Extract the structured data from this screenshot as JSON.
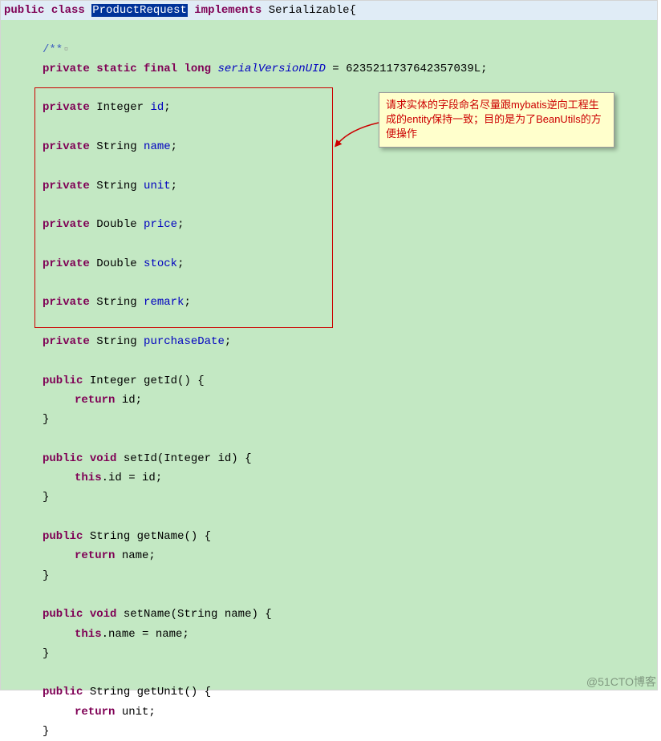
{
  "decl": {
    "public": "public",
    "class": "class",
    "name": "ProductRequest",
    "implements": "implements",
    "iface": "Serializable{"
  },
  "comment": "/**",
  "svuid_line": {
    "mods": "private static final",
    "type": "long",
    "name": "serialVersionUID",
    "eq": " = ",
    "val": "6235211737642357039L;"
  },
  "fields": [
    {
      "mod": "private",
      "type": "Integer",
      "name": "id"
    },
    {
      "mod": "private",
      "type": "String",
      "name": "name"
    },
    {
      "mod": "private",
      "type": "String",
      "name": "unit"
    },
    {
      "mod": "private",
      "type": "Double",
      "name": "price"
    },
    {
      "mod": "private",
      "type": "Double",
      "name": "stock"
    },
    {
      "mod": "private",
      "type": "String",
      "name": "remark"
    },
    {
      "mod": "private",
      "type": "String",
      "name": "purchaseDate"
    }
  ],
  "methods": [
    {
      "sig_pre": "public",
      "ret": "Integer",
      "name": "getId()",
      "open": " {",
      "body_kw": "return",
      "body_rest": " id;",
      "close": "}"
    },
    {
      "sig_pre": "public",
      "ret": "void",
      "name": "setId(Integer id)",
      "open": " {",
      "body_kw": "this",
      "body_rest": ".id = id;",
      "close": "}"
    },
    {
      "sig_pre": "public",
      "ret": "String",
      "name": "getName()",
      "open": " {",
      "body_kw": "return",
      "body_rest": " name;",
      "close": "}"
    },
    {
      "sig_pre": "public",
      "ret": "void",
      "name": "setName(String name)",
      "open": " {",
      "body_kw": "this",
      "body_rest": ".name = name;",
      "close": "}"
    },
    {
      "sig_pre": "public",
      "ret": "String",
      "name": "getUnit()",
      "open": " {",
      "body_kw": "return",
      "body_rest": " unit;",
      "close": "}"
    }
  ],
  "annotation_text": "请求实体的字段命名尽量跟mybatis逆向工程生成的entity保持一致；目的是为了BeanUtils的方便操作",
  "watermark": "@51CTO博客"
}
